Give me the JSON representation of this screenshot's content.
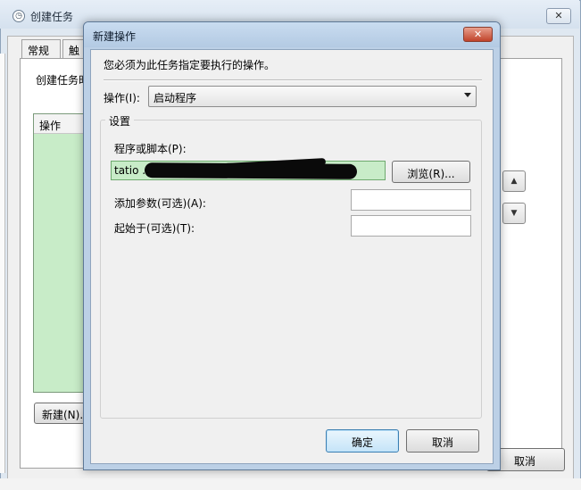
{
  "background_window": {
    "title": "创建任务",
    "close_glyph": "✕",
    "title_icon": "clock-icon",
    "tabs": [
      {
        "label": "常规"
      },
      {
        "label": "触发"
      }
    ],
    "description_partial": "创建任务时",
    "list_header": "操作",
    "new_button_label": "新建(N)...",
    "up_glyph": "▲",
    "down_glyph": "▼",
    "cancel_button_label": "取消"
  },
  "dialog": {
    "title": "新建操作",
    "close_glyph": "✕",
    "message": "您必须为此任务指定要执行的操作。",
    "action_label": "操作(I):",
    "action_value": "启动程序",
    "settings_group_label": "设置",
    "program_label": "程序或脚本(P):",
    "program_value_visible": "tatio                                          .exe\"",
    "browse_button_label": "浏览(R)...",
    "arguments_label": "添加参数(可选)(A):",
    "arguments_value": "",
    "start_in_label": "起始于(可选)(T):",
    "start_in_value": "",
    "ok_button_label": "确定",
    "cancel_button_label": "取消"
  },
  "colors": {
    "dialog_frame": "#bcd0e6",
    "client_bg": "#f0f0f0",
    "highlight_green": "#c8ecc8",
    "close_red": "#c0432a",
    "ok_blue": "#c5e4f8"
  }
}
